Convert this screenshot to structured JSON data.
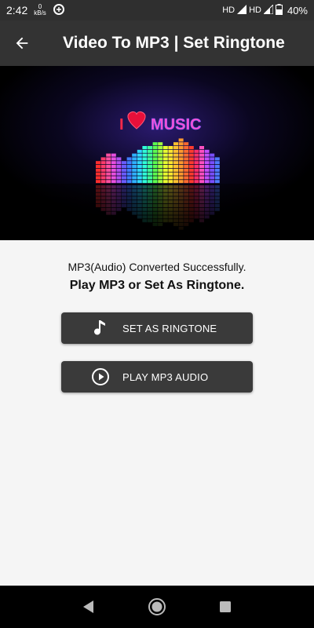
{
  "status_bar": {
    "time": "2:42",
    "net_speed_value": "0",
    "net_speed_unit": "kB/s",
    "hd1": "HD",
    "hd2": "HD",
    "battery_pct": "40%"
  },
  "app_bar": {
    "title": "Video To MP3 | Set Ringtone",
    "back_icon": "arrow-left-icon"
  },
  "hero": {
    "banner_text": "MUSIC",
    "banner_i": "I"
  },
  "content": {
    "message_line1": "MP3(Audio) Converted Successfully.",
    "message_line2": "Play MP3 or Set As Ringtone."
  },
  "buttons": {
    "ringtone_label": "SET AS RINGTONE",
    "ringtone_icon": "music-note-icon",
    "play_label": "PLAY MP3 AUDIO",
    "play_icon": "play-circle-icon"
  },
  "nav_bar": {
    "back_icon": "nav-back-icon",
    "home_icon": "nav-home-icon",
    "recents_icon": "nav-recents-icon"
  },
  "colors": {
    "app_bar": "#333333",
    "button": "#3a3a3a",
    "status_bar": "#2f2f2f",
    "background": "#f5f5f5"
  }
}
